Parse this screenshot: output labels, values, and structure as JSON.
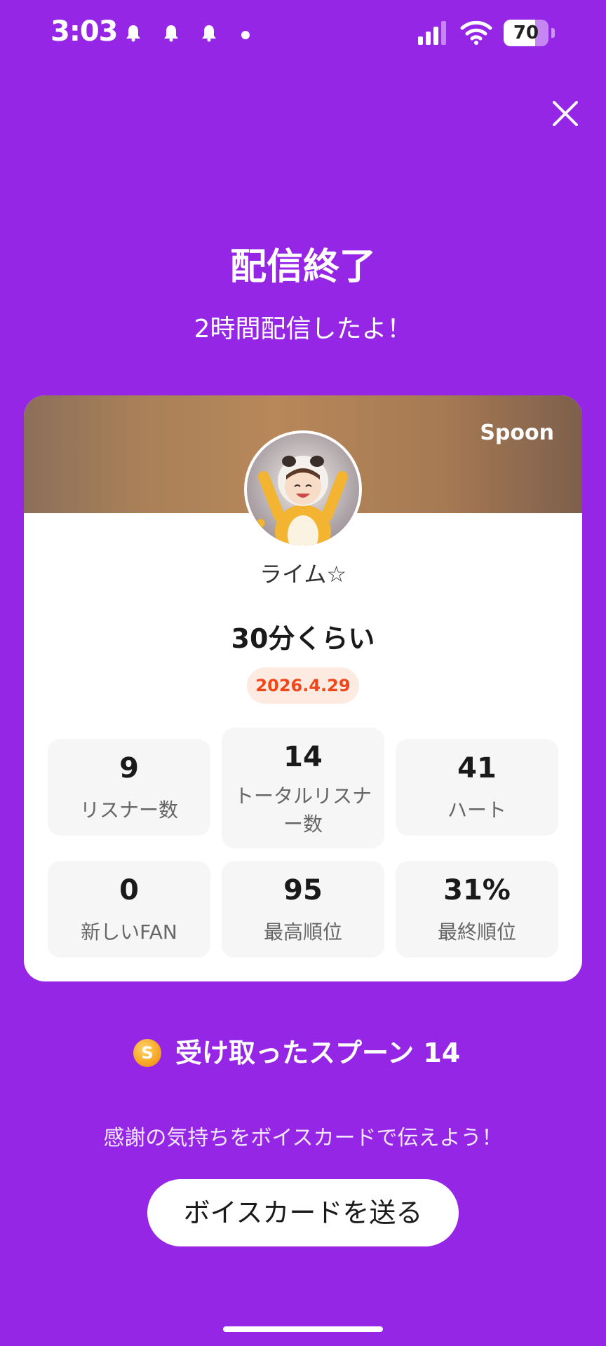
{
  "status_bar": {
    "time": "3:03",
    "battery_level": 70,
    "battery_text": "70"
  },
  "heading": {
    "title": "配信終了",
    "subtitle": "2時間配信したよ！"
  },
  "card": {
    "brand": "Spoon",
    "username": "ライム☆",
    "duration": "30分くらい",
    "date": "2026.4.29",
    "stats": [
      {
        "value": "9",
        "label": "リスナー数"
      },
      {
        "value": "14",
        "label": "トータルリスナー数"
      },
      {
        "value": "41",
        "label": "ハート"
      },
      {
        "value": "0",
        "label": "新しいFAN"
      },
      {
        "value": "95",
        "label": "最高順位"
      },
      {
        "value": "31%",
        "label": "最終順位"
      }
    ]
  },
  "spoons": {
    "coin_glyph": "S",
    "label": "受け取ったスプーン 14"
  },
  "thanks_text": "感謝の気持ちをボイスカードで伝えよう！",
  "voice_card_button": "ボイスカードを送る",
  "colors": {
    "background": "#9626E6",
    "date_badge_text": "#F0471A",
    "date_badge_bg": "#FDEAE1"
  },
  "icons": [
    "notification-bell-icon",
    "signal-icon",
    "wifi-icon",
    "battery-icon",
    "close-icon",
    "spoon-coin-icon"
  ]
}
